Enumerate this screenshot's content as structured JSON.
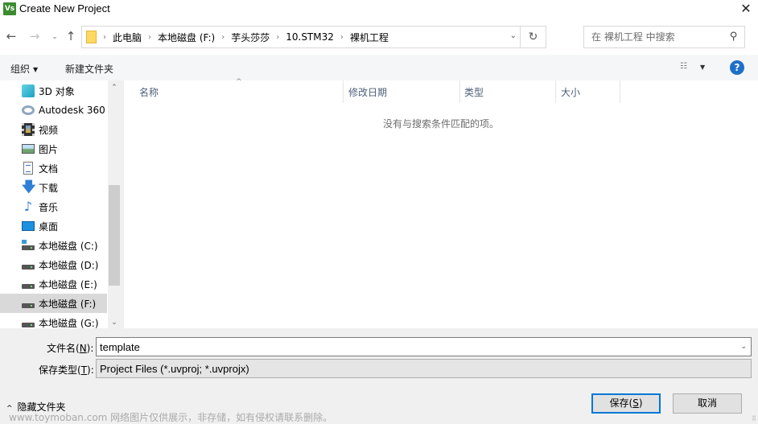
{
  "window": {
    "title": "Create New Project",
    "app_icon_text": "Vs",
    "close_glyph": "✕"
  },
  "nav": {
    "back_glyph": "←",
    "forward_glyph": "→",
    "recent_glyph": "⌄",
    "up_glyph": "↑",
    "breadcrumbs": [
      "此电脑",
      "本地磁盘 (F:)",
      "芋头莎莎",
      "10.STM32",
      "裸机工程"
    ],
    "crumb_separator": "›",
    "dropdown_glyph": "⌄",
    "refresh_glyph": "↻",
    "search_placeholder": "在 裸机工程 中搜索",
    "search_glyph": "⚲"
  },
  "toolbar": {
    "organize_label": "组织",
    "organize_caret": "▼",
    "new_folder_label": "新建文件夹",
    "view_glyph": "☷",
    "view_caret": "▼",
    "help_glyph": "?"
  },
  "sidebar": {
    "items": [
      {
        "label": "3D 对象",
        "icon": "3d-objects-icon",
        "selected": false
      },
      {
        "label": "Autodesk 360",
        "icon": "cloud-icon",
        "selected": false
      },
      {
        "label": "视频",
        "icon": "video-icon",
        "selected": false
      },
      {
        "label": "图片",
        "icon": "pictures-icon",
        "selected": false
      },
      {
        "label": "文档",
        "icon": "documents-icon",
        "selected": false
      },
      {
        "label": "下载",
        "icon": "downloads-icon",
        "selected": false
      },
      {
        "label": "音乐",
        "icon": "music-icon",
        "selected": false
      },
      {
        "label": "桌面",
        "icon": "desktop-icon",
        "selected": false
      },
      {
        "label": "本地磁盘 (C:)",
        "icon": "system-drive-icon",
        "selected": false
      },
      {
        "label": "本地磁盘 (D:)",
        "icon": "drive-icon",
        "selected": false
      },
      {
        "label": "本地磁盘 (E:)",
        "icon": "drive-icon",
        "selected": false
      },
      {
        "label": "本地磁盘 (F:)",
        "icon": "drive-icon",
        "selected": true
      },
      {
        "label": "本地磁盘 (G:)",
        "icon": "drive-icon",
        "selected": false
      }
    ],
    "download_glyph": "🡇",
    "music_glyph": "♪",
    "scroll_up_glyph": "⌃",
    "scroll_down_glyph": "⌄",
    "scroll_thumb_start": 0.41,
    "scroll_thumb_end": 0.87
  },
  "filelist": {
    "columns": [
      "名称",
      "修改日期",
      "类型",
      "大小"
    ],
    "sort_glyph": "^",
    "empty_message": "没有与搜索条件匹配的项。"
  },
  "form": {
    "filename_label_pre": "文件名(",
    "filename_label_key": "N",
    "filename_label_post": "):",
    "filename_value": "template",
    "filetype_label_pre": "保存类型(",
    "filetype_label_key": "T",
    "filetype_label_post": "):",
    "filetype_value": "Project Files (*.uvproj; *.uvprojx)",
    "dropdown_glyph": "⌄"
  },
  "footer": {
    "hide_folders_caret": "^",
    "hide_folders_label": "隐藏文件夹",
    "save_label_pre": "保存(",
    "save_label_key": "S",
    "save_label_post": ")",
    "cancel_label": "取消",
    "watermark": "www.toymoban.com 网络图片仅供展示，非存储，如有侵权请联系删除。",
    "grip_glyph": "⠿"
  }
}
